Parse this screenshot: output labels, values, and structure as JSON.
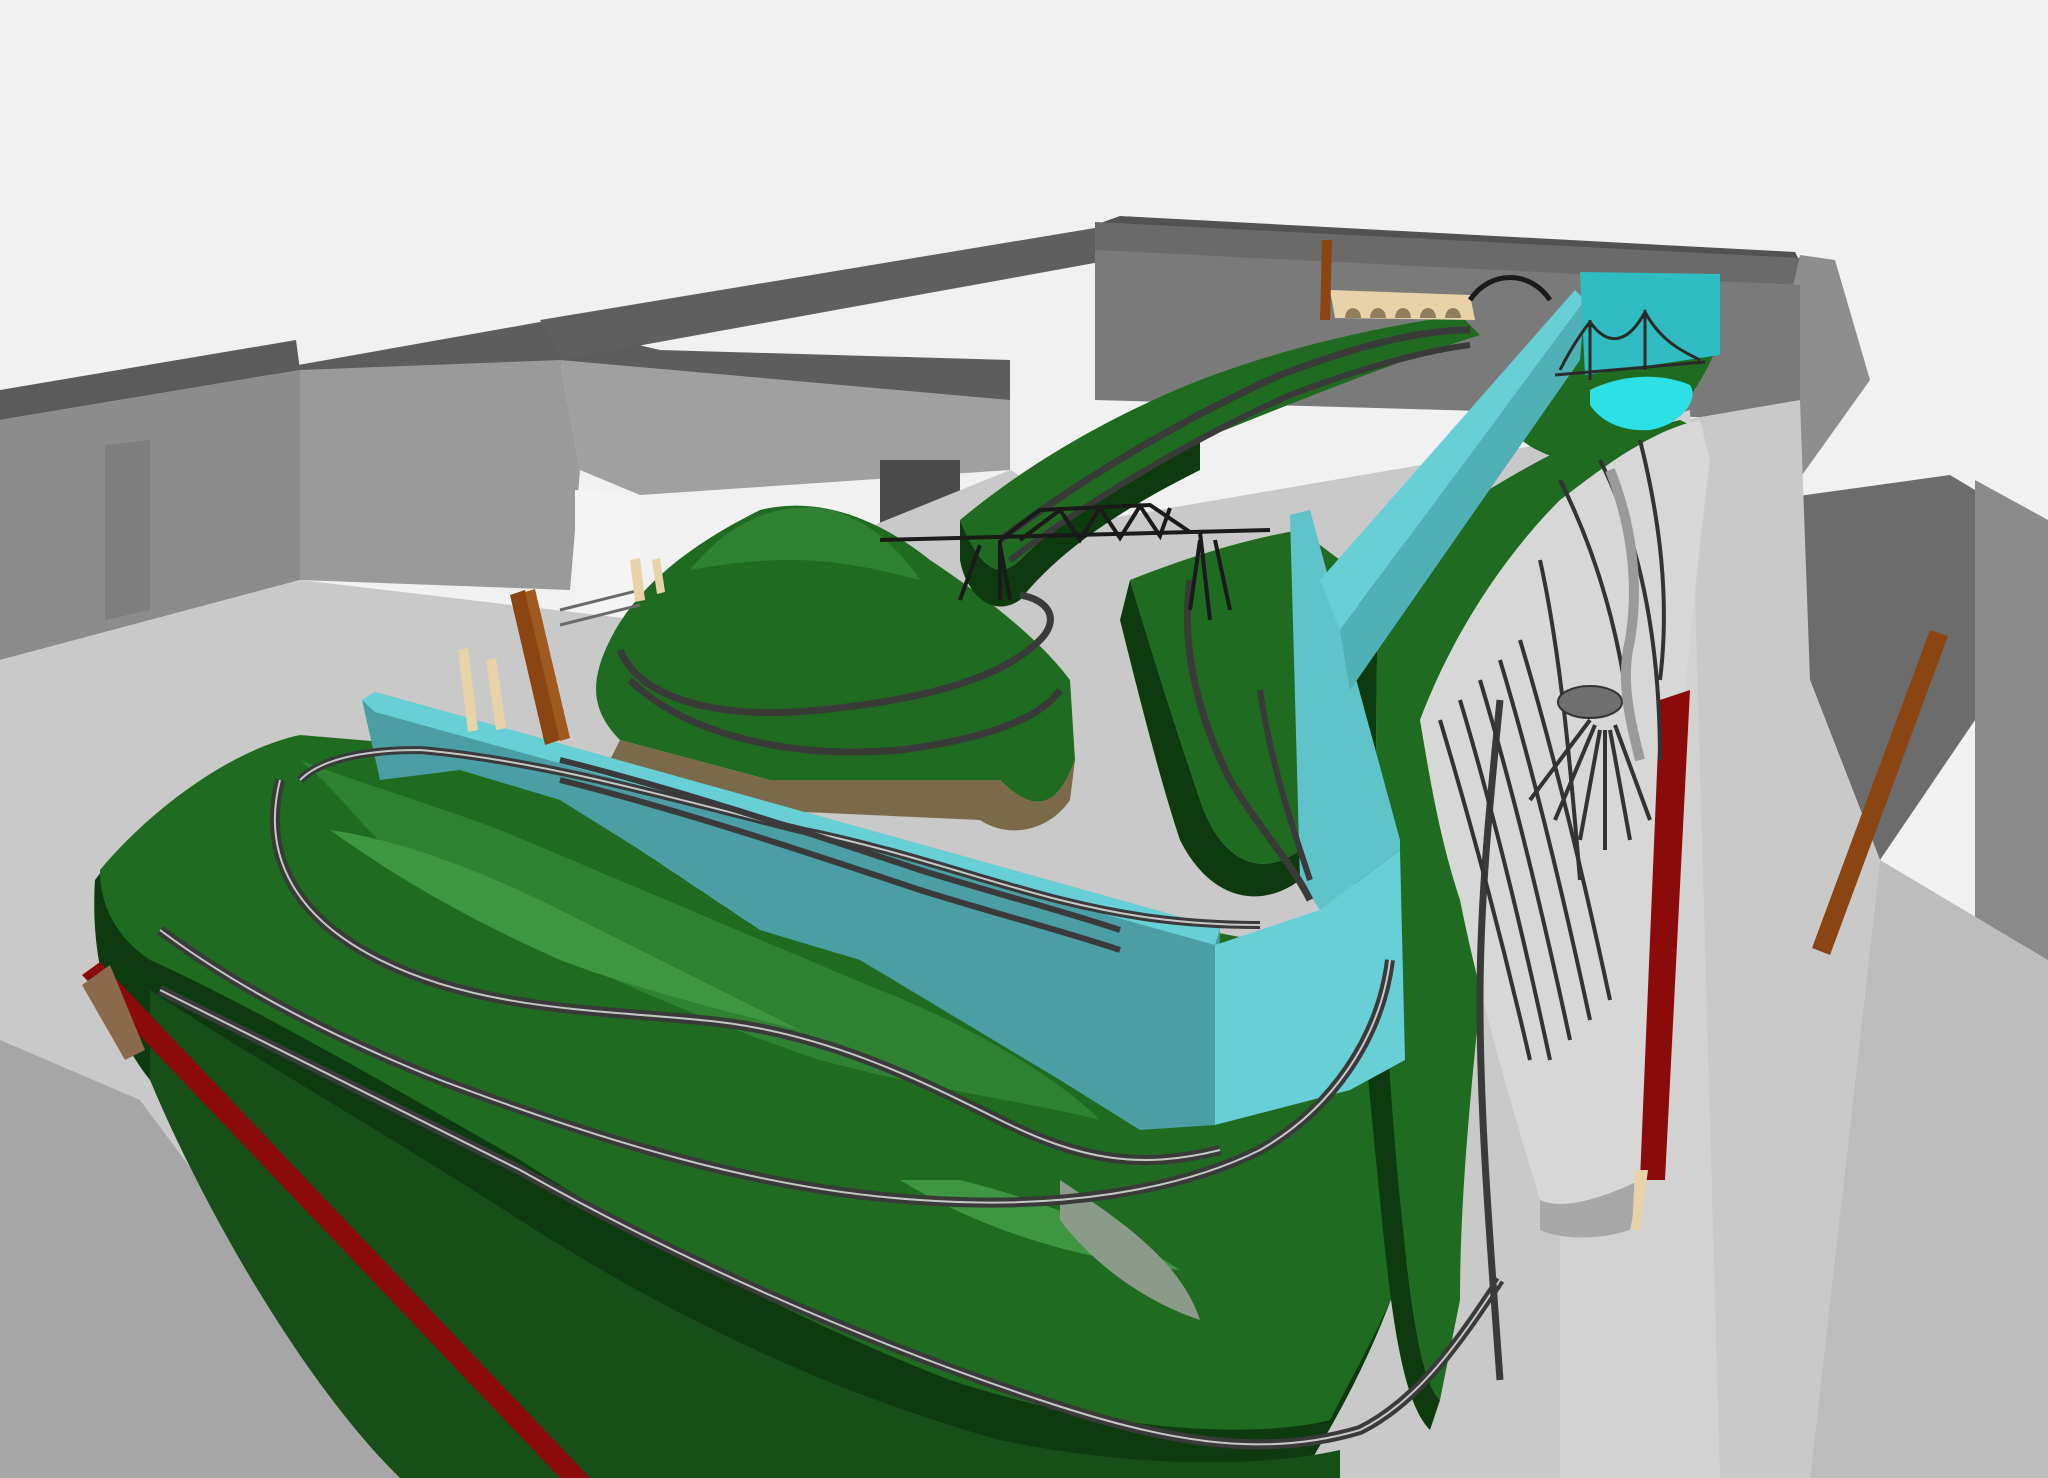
{
  "scene": {
    "colors": {
      "background": "#f1f1f1",
      "floor": "#c9c9c9",
      "wall_top": "#5b5b5b",
      "wall_side": "#8e8e8e",
      "wall_light": "#a8a8a8",
      "terrain_dark": "#0e3a10",
      "terrain": "#1f6b1f",
      "terrain_light": "#3f9640",
      "backdrop": "#67cfd6",
      "backdrop_shade": "#4b9ea3",
      "water": "#2de0e6",
      "track": "#3a3a3a",
      "rail": "#c8c8c8",
      "fascia_red": "#8b0a0a",
      "post_wood": "#8a4513",
      "support_beige": "#e8d3a8",
      "bridge": "#1a1a1a"
    },
    "objects": [
      "room-walls",
      "layout-benchwork",
      "scenery-backdrop",
      "central-mountain",
      "truss-bridge",
      "arch-viaduct",
      "suspension-bridge",
      "water-pond",
      "rail-yard",
      "turntable",
      "track-mainline"
    ]
  }
}
